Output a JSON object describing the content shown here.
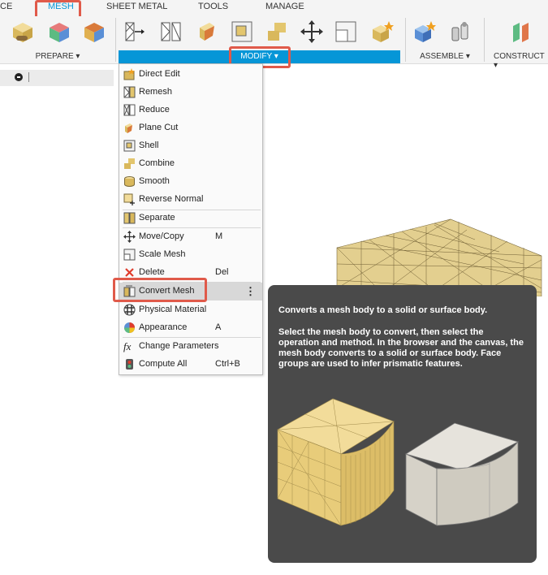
{
  "ribbon": {
    "tabs": [
      {
        "label": "CE"
      },
      {
        "label": "MESH"
      },
      {
        "label": "SHEET METAL"
      },
      {
        "label": "TOOLS"
      },
      {
        "label": "MANAGE"
      }
    ],
    "groups": {
      "prepare": "PREPARE ▾",
      "modify": "MODIFY ▾",
      "assemble": "ASSEMBLE ▾",
      "construct": "CONSTRUCT ▾"
    }
  },
  "modify_menu": {
    "items": [
      {
        "label": "Direct Edit",
        "icon": "direct-edit-icon",
        "shortcut": ""
      },
      {
        "label": "Remesh",
        "icon": "remesh-icon",
        "shortcut": ""
      },
      {
        "label": "Reduce",
        "icon": "reduce-icon",
        "shortcut": ""
      },
      {
        "label": "Plane Cut",
        "icon": "plane-cut-icon",
        "shortcut": ""
      },
      {
        "label": "Shell",
        "icon": "shell-icon",
        "shortcut": ""
      },
      {
        "label": "Combine",
        "icon": "combine-icon",
        "shortcut": ""
      },
      {
        "label": "Smooth",
        "icon": "smooth-icon",
        "shortcut": ""
      },
      {
        "label": "Reverse Normal",
        "icon": "reverse-normal-icon",
        "shortcut": ""
      },
      {
        "label": "Separate",
        "icon": "separate-icon",
        "shortcut": ""
      },
      {
        "label": "Move/Copy",
        "icon": "move-icon",
        "shortcut": "M"
      },
      {
        "label": "Scale Mesh",
        "icon": "scale-icon",
        "shortcut": ""
      },
      {
        "label": "Delete",
        "icon": "delete-icon",
        "shortcut": "Del"
      },
      {
        "label": "Convert Mesh",
        "icon": "convert-mesh-icon",
        "shortcut": ""
      },
      {
        "label": "Physical Material",
        "icon": "physical-material-icon",
        "shortcut": ""
      },
      {
        "label": "Appearance",
        "icon": "appearance-icon",
        "shortcut": "A"
      },
      {
        "label": "Change Parameters",
        "icon": "fx-icon",
        "shortcut": ""
      },
      {
        "label": "Compute All",
        "icon": "compute-all-icon",
        "shortcut": "Ctrl+B"
      }
    ],
    "highlighted": "Convert Mesh",
    "more_label": "⋮"
  },
  "tooltip": {
    "title": "Converts a mesh body to a solid or surface body.",
    "body": "Select the mesh body to convert, then select the operation and method. In the browser and the canvas, the mesh body converts to a solid or surface body. Face groups are used to infer prismatic features."
  },
  "colors": {
    "accent": "#0696d7",
    "callout": "#e05a4a",
    "mesh_tan": "#e3cf8f",
    "tooltip_bg": "#4a4a4a"
  }
}
